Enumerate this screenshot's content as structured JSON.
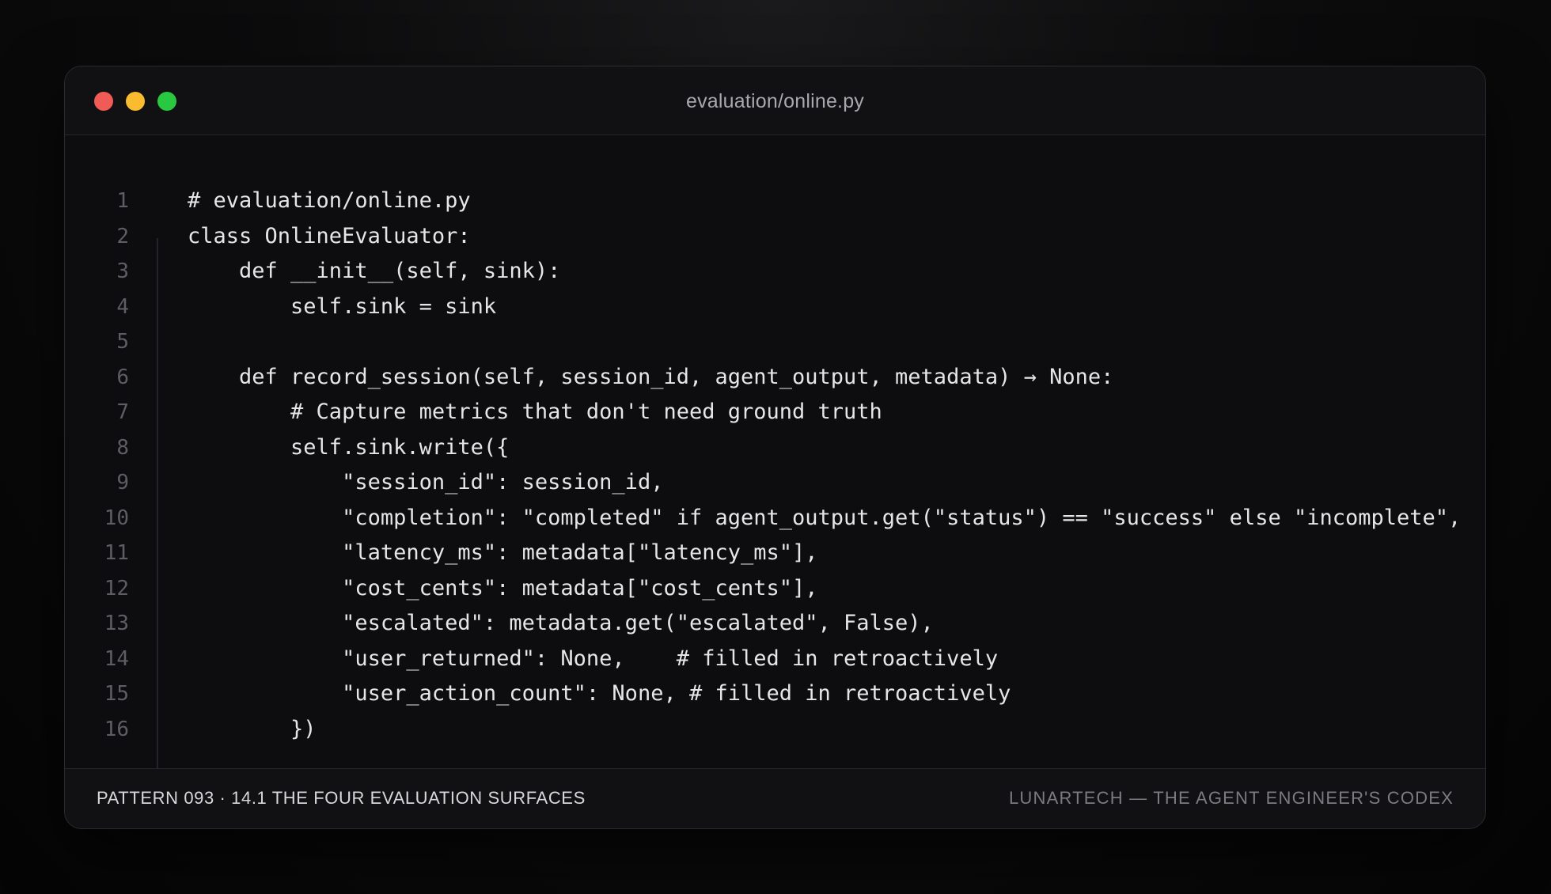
{
  "window": {
    "title": "evaluation/online.py",
    "controls": {
      "close_color": "#f05b55",
      "minimize_color": "#f8bc2e",
      "maximize_color": "#28c941"
    }
  },
  "code": {
    "language": "python",
    "lines": [
      {
        "num": "1",
        "text": "# evaluation/online.py"
      },
      {
        "num": "2",
        "text": "class OnlineEvaluator:"
      },
      {
        "num": "3",
        "text": "    def __init__(self, sink):"
      },
      {
        "num": "4",
        "text": "        self.sink = sink"
      },
      {
        "num": "5",
        "text": ""
      },
      {
        "num": "6",
        "text": "    def record_session(self, session_id, agent_output, metadata) → None:"
      },
      {
        "num": "7",
        "text": "        # Capture metrics that don't need ground truth"
      },
      {
        "num": "8",
        "text": "        self.sink.write({"
      },
      {
        "num": "9",
        "text": "            \"session_id\": session_id,"
      },
      {
        "num": "10",
        "text": "            \"completion\": \"completed\" if agent_output.get(\"status\") == \"success\" else \"incomplete\","
      },
      {
        "num": "11",
        "text": "            \"latency_ms\": metadata[\"latency_ms\"],"
      },
      {
        "num": "12",
        "text": "            \"cost_cents\": metadata[\"cost_cents\"],"
      },
      {
        "num": "13",
        "text": "            \"escalated\": metadata.get(\"escalated\", False),"
      },
      {
        "num": "14",
        "text": "            \"user_returned\": None,    # filled in retroactively"
      },
      {
        "num": "15",
        "text": "            \"user_action_count\": None, # filled in retroactively"
      },
      {
        "num": "16",
        "text": "        })"
      }
    ]
  },
  "footer": {
    "left": "PATTERN 093 · 14.1 THE FOUR EVALUATION SURFACES",
    "right": "LUNARTECH — THE AGENT ENGINEER'S CODEX"
  }
}
